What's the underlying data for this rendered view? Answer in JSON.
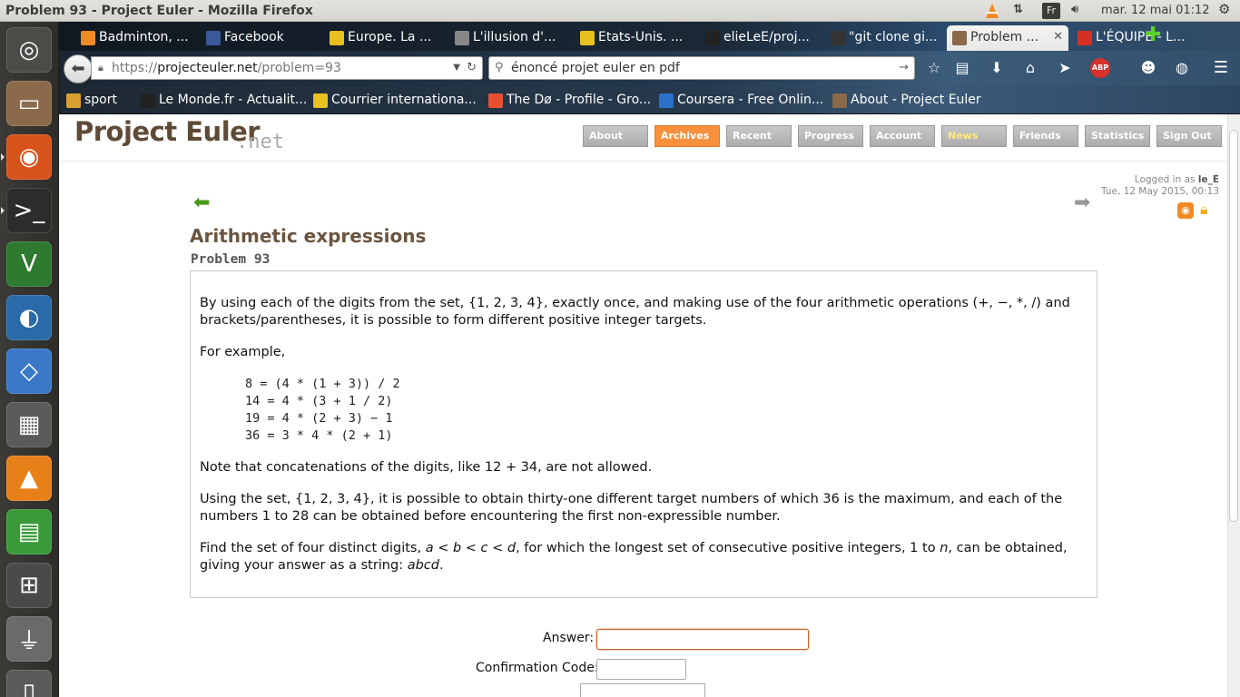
{
  "system": {
    "window_title": "Problem 93 - Project Euler - Mozilla Firefox",
    "keyboard": "Fr",
    "clock": "mar. 12 mai 01:12"
  },
  "launcher": [
    {
      "name": "ubuntu-dash",
      "glyph": "◎",
      "bg": "#4c4b47"
    },
    {
      "name": "files",
      "glyph": "▭",
      "bg": "#8a6a4a"
    },
    {
      "name": "firefox",
      "glyph": "◉",
      "bg": "#d8531a"
    },
    {
      "name": "terminal",
      "glyph": ">_",
      "bg": "#2c2c2c"
    },
    {
      "name": "vim",
      "glyph": "V",
      "bg": "#2e7a2e"
    },
    {
      "name": "network",
      "glyph": "◐",
      "bg": "#2a6aa8"
    },
    {
      "name": "virtualbox",
      "glyph": "◇",
      "bg": "#3a78c8"
    },
    {
      "name": "calculator",
      "glyph": "▦",
      "bg": "#5a5a5a"
    },
    {
      "name": "vlc",
      "glyph": "▲",
      "bg": "#e8801a"
    },
    {
      "name": "spreadsheet",
      "glyph": "▤",
      "bg": "#3a9a3a"
    },
    {
      "name": "workspaces",
      "glyph": "⊞",
      "bg": "#4a4a4a"
    },
    {
      "name": "usb-drive",
      "glyph": "⏚",
      "bg": "#6a6a6a"
    },
    {
      "name": "trash",
      "glyph": "▯",
      "bg": "#5a5a5a"
    }
  ],
  "tabs": [
    {
      "label": "Badminton, ...",
      "color": "#f08a24"
    },
    {
      "label": "Facebook",
      "color": "#3b5998"
    },
    {
      "label": "Europe. La ...",
      "color": "#e8c020"
    },
    {
      "label": "L'illusion d'...",
      "color": "#888"
    },
    {
      "label": "Etats-Unis. ...",
      "color": "#e8c020"
    },
    {
      "label": "elieLeE/proj...",
      "color": "#222"
    },
    {
      "label": "\"git clone gi...",
      "color": "#333"
    },
    {
      "label": "Problem ...",
      "color": "#8a6a4a"
    },
    {
      "label": "L'ÉQUIPE - L...",
      "color": "#d83020"
    }
  ],
  "url": {
    "protocol": "https://",
    "host": "projecteuler.net",
    "path": "/problem=93"
  },
  "search": {
    "value": "énoncé projet euler en pdf"
  },
  "bookmarks": [
    {
      "label": "sport",
      "color": "#d8a030"
    },
    {
      "label": "Le Monde.fr - Actualit...",
      "color": "#222"
    },
    {
      "label": "Courrier internationa...",
      "color": "#e8c020"
    },
    {
      "label": "The Dø - Profile - Gro...",
      "color": "#e85030"
    },
    {
      "label": "Coursera - Free Onlin...",
      "color": "#2a72c8"
    },
    {
      "label": "About - Project Euler",
      "color": "#8a6a4a"
    }
  ],
  "site": {
    "logo": "Project Euler",
    "logo_suffix": ".net",
    "nav": [
      "About",
      "Archives",
      "Recent",
      "Progress",
      "Account",
      "News",
      "Friends",
      "Statistics",
      "Sign Out"
    ],
    "active_nav": "Archives",
    "logged_in_prefix": "Logged in as ",
    "username": "le_E",
    "datetime": "Tue, 12 May 2015, 00:13"
  },
  "problem": {
    "title": "Arithmetic expressions",
    "number": "Problem 93",
    "para1": "By using each of the digits from the set, {1, 2, 3, 4}, exactly once, and making use of the four arithmetic operations (+, −, *, /) and brackets/parentheses, it is possible to form different positive integer targets.",
    "para2": "For example,",
    "examples": [
      "8 = (4 * (1 + 3)) / 2",
      "14 = 4 * (3 + 1 / 2)",
      "19 = 4 * (2 + 3) − 1",
      "36 = 3 * 4 * (2 + 1)"
    ],
    "para3": "Note that concatenations of the digits, like 12 + 34, are not allowed.",
    "para4": "Using the set, {1, 2, 3, 4}, it is possible to obtain thirty-one different target numbers of which 36 is the maximum, and each of the numbers 1 to 28 can be obtained before encountering the first non-expressible number.",
    "para5_a": "Find the set of four distinct digits, ",
    "para5_vars": "a < b < c < d",
    "para5_b": ", for which the longest set of consecutive positive integers, 1 to ",
    "para5_n": "n",
    "para5_c": ", can be obtained, giving your answer as a string: ",
    "para5_ans": "abcd",
    "para5_end": "."
  },
  "form": {
    "answer_label": "Answer:",
    "answer_value": "",
    "confirm_label": "Confirmation Code:"
  }
}
